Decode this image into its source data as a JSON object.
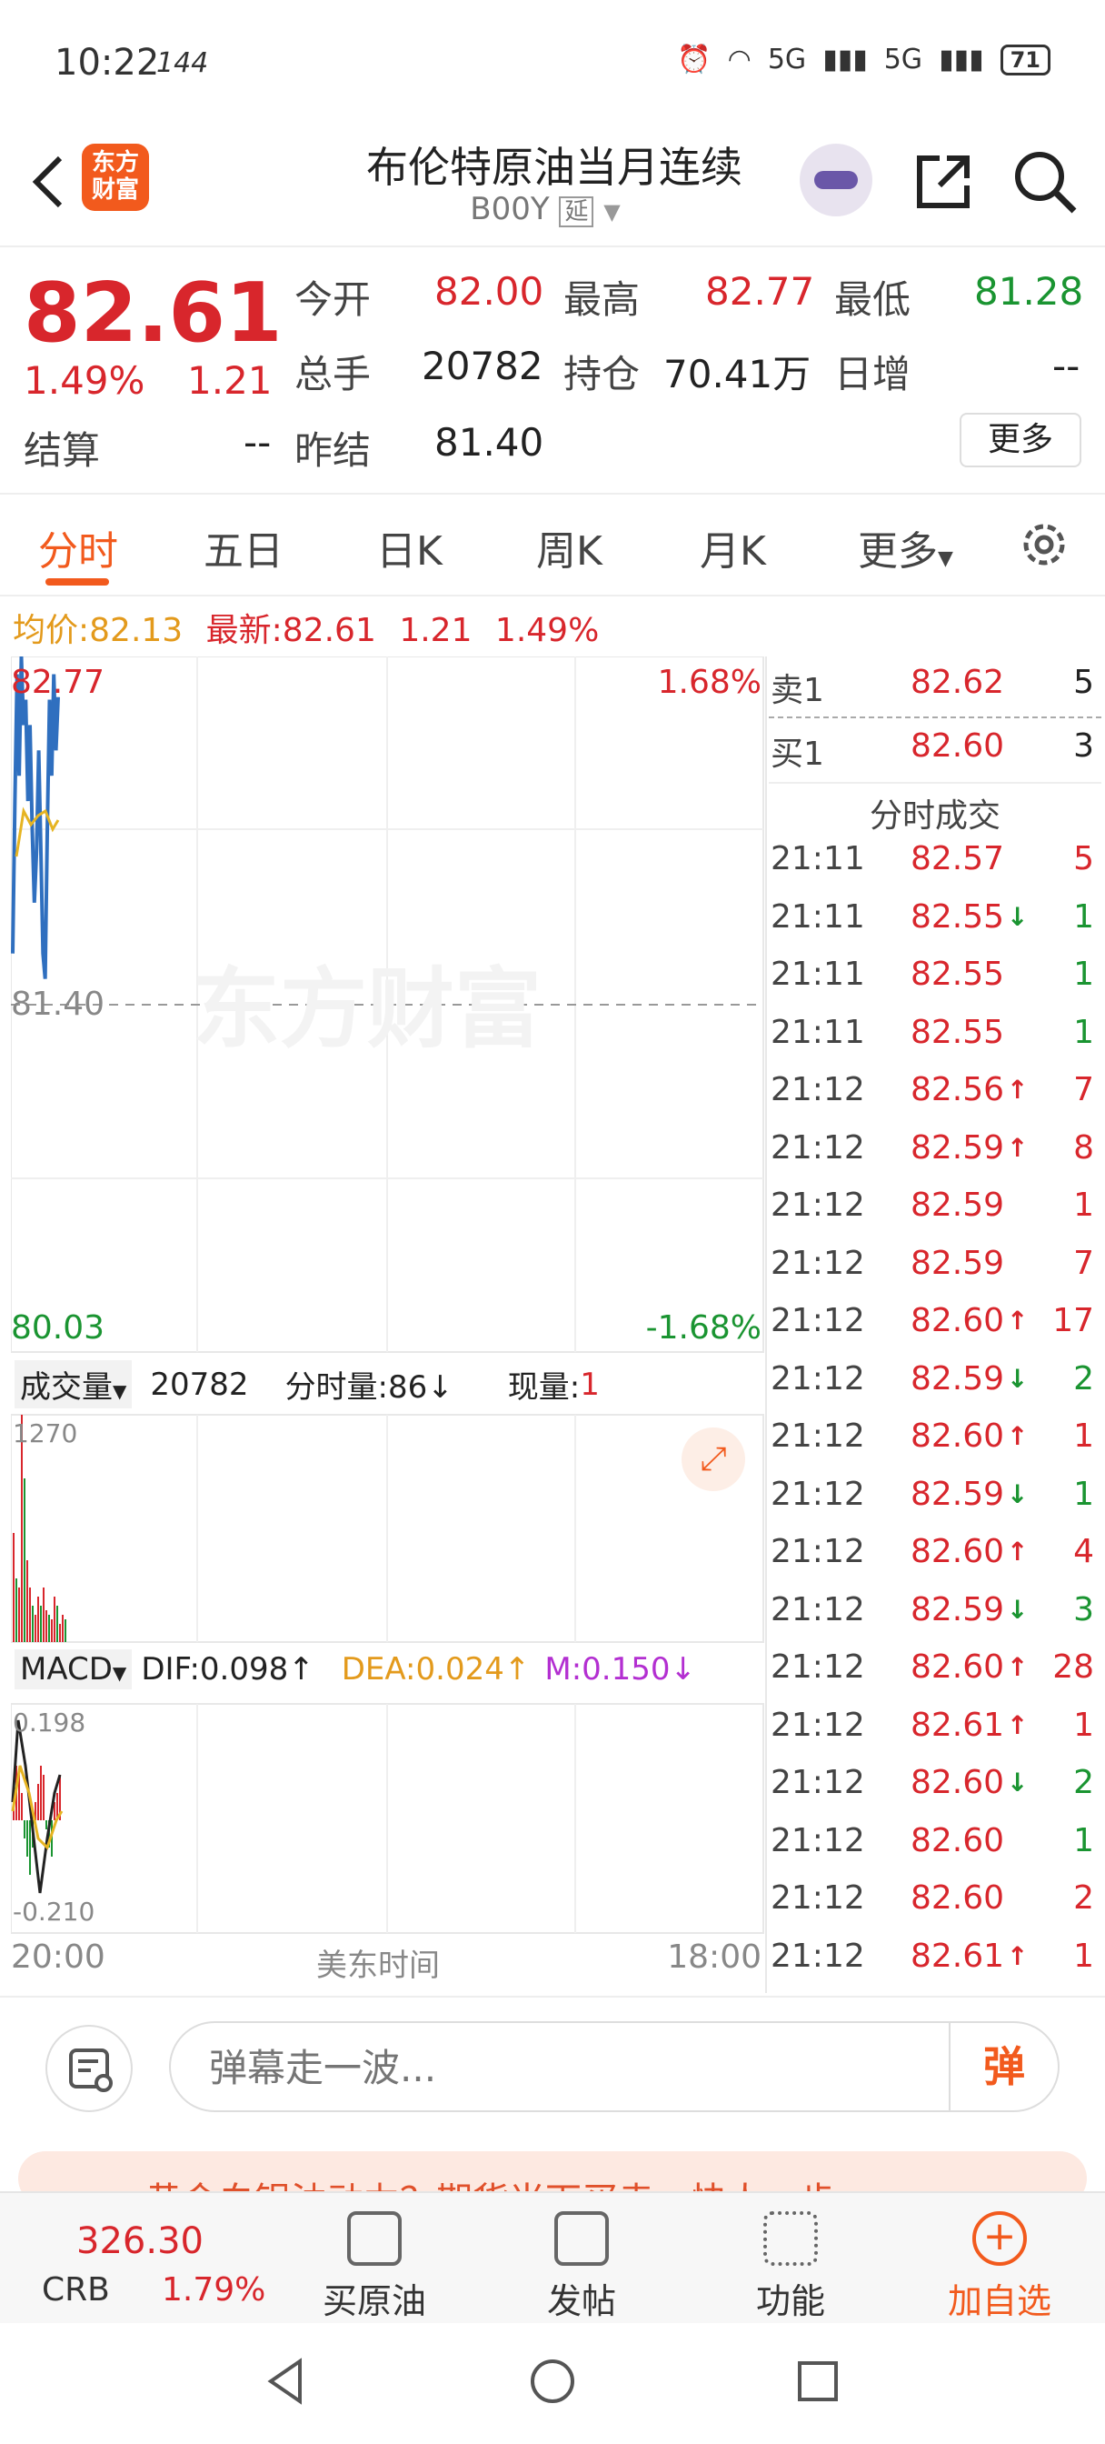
{
  "status": {
    "time": "10:22",
    "refresh": "144",
    "battery": "71",
    "net1": "5G",
    "net2": "5G"
  },
  "header": {
    "logo": "东方财富",
    "title": "布伦特原油当月连续",
    "code": "B00Y",
    "delay_tag": "延"
  },
  "quote": {
    "price": "82.61",
    "change_pct": "1.49%",
    "change": "1.21",
    "labels": {
      "open": "今开",
      "high": "最高",
      "low": "最低",
      "volume": "总手",
      "oi": "持仓",
      "daily_inc": "日增",
      "settle": "结算",
      "prev_settle": "昨结",
      "more": "更多"
    },
    "open": "82.00",
    "high": "82.77",
    "low": "81.28",
    "volume": "20782",
    "oi": "70.41万",
    "daily_inc": "--",
    "settle": "--",
    "prev_settle": "81.40"
  },
  "tabs": [
    "分时",
    "五日",
    "日K",
    "周K",
    "月K",
    "更多"
  ],
  "infoline": {
    "avg_label": "均价:",
    "avg": "82.13",
    "latest_label": "最新:",
    "latest": "82.61",
    "chg": "1.21",
    "pct": "1.49%"
  },
  "chart": {
    "top_price": "82.77",
    "top_pct": "1.68%",
    "mid_price": "81.40",
    "bottom_price": "80.03",
    "bottom_pct": "-1.68%",
    "watermark": "东方财富",
    "volume_label": "成交量",
    "volume_total": "20782",
    "fenshi_label": "分时量:86",
    "fenshi_arrow": "↓",
    "xianliang_label": "现量:",
    "xianliang": "1",
    "vol_max": "1270",
    "macd_label": "MACD",
    "dif": "DIF:0.098",
    "dif_arrow": "↑",
    "dea": "DEA:0.024",
    "dea_arrow": "↑",
    "m": "M:0.150",
    "m_arrow": "↓",
    "macd_max": "0.198",
    "macd_min": "-0.210",
    "time_start": "20:00",
    "time_label": "美东时间",
    "time_end": "18:00",
    "colors": {
      "up": "#d8262c",
      "down": "#1a9431",
      "line": "#2f6fbf",
      "avg": "#e6b422"
    }
  },
  "chart_data": {
    "type": "line",
    "xlabel": "美东时间",
    "ylim": [
      80.03,
      82.77
    ],
    "price_series": [
      81.6,
      82.2,
      82.7,
      82.3,
      82.77,
      82.5,
      82.6,
      82.2,
      82.5,
      82.1,
      81.8,
      82.0,
      82.4,
      82.0,
      81.6,
      81.5,
      82.1,
      82.6,
      82.3,
      82.7,
      82.4,
      82.61
    ]
  },
  "orderbook": {
    "ask_label": "卖1",
    "ask_price": "82.62",
    "ask_vol": "5",
    "bid_label": "买1",
    "bid_price": "82.60",
    "bid_vol": "3",
    "trades_title": "分时成交"
  },
  "trades": [
    {
      "t": "21:11",
      "p": "82.57",
      "a": "",
      "v": "5",
      "c": "red"
    },
    {
      "t": "21:11",
      "p": "82.55",
      "a": "↓",
      "v": "1",
      "c": "green"
    },
    {
      "t": "21:11",
      "p": "82.55",
      "a": "",
      "v": "1",
      "c": "green"
    },
    {
      "t": "21:11",
      "p": "82.55",
      "a": "",
      "v": "1",
      "c": "green"
    },
    {
      "t": "21:12",
      "p": "82.56",
      "a": "↑",
      "v": "7",
      "c": "red"
    },
    {
      "t": "21:12",
      "p": "82.59",
      "a": "↑",
      "v": "8",
      "c": "red"
    },
    {
      "t": "21:12",
      "p": "82.59",
      "a": "",
      "v": "1",
      "c": "red"
    },
    {
      "t": "21:12",
      "p": "82.59",
      "a": "",
      "v": "7",
      "c": "red"
    },
    {
      "t": "21:12",
      "p": "82.60",
      "a": "↑",
      "v": "17",
      "c": "red"
    },
    {
      "t": "21:12",
      "p": "82.59",
      "a": "↓",
      "v": "2",
      "c": "green"
    },
    {
      "t": "21:12",
      "p": "82.60",
      "a": "↑",
      "v": "1",
      "c": "red"
    },
    {
      "t": "21:12",
      "p": "82.59",
      "a": "↓",
      "v": "1",
      "c": "green"
    },
    {
      "t": "21:12",
      "p": "82.60",
      "a": "↑",
      "v": "4",
      "c": "red"
    },
    {
      "t": "21:12",
      "p": "82.59",
      "a": "↓",
      "v": "3",
      "c": "green"
    },
    {
      "t": "21:12",
      "p": "82.60",
      "a": "↑",
      "v": "28",
      "c": "red"
    },
    {
      "t": "21:12",
      "p": "82.61",
      "a": "↑",
      "v": "1",
      "c": "red"
    },
    {
      "t": "21:12",
      "p": "82.60",
      "a": "↓",
      "v": "2",
      "c": "green"
    },
    {
      "t": "21:12",
      "p": "82.60",
      "a": "",
      "v": "1",
      "c": "green"
    },
    {
      "t": "21:12",
      "p": "82.60",
      "a": "",
      "v": "2",
      "c": "red"
    },
    {
      "t": "21:12",
      "p": "82.61",
      "a": "↑",
      "v": "1",
      "c": "red"
    }
  ],
  "comment": {
    "placeholder": "弹幕走一波...",
    "send_label": "弹"
  },
  "banner": {
    "text": "黄金白银油动力？期货当下买卖，快人一步"
  },
  "toolbar": {
    "crb_value": "326.30",
    "crb_label": "CRB",
    "crb_pct": "1.79%",
    "buy": "买原油",
    "post": "发帖",
    "func": "功能",
    "add": "加自选"
  }
}
